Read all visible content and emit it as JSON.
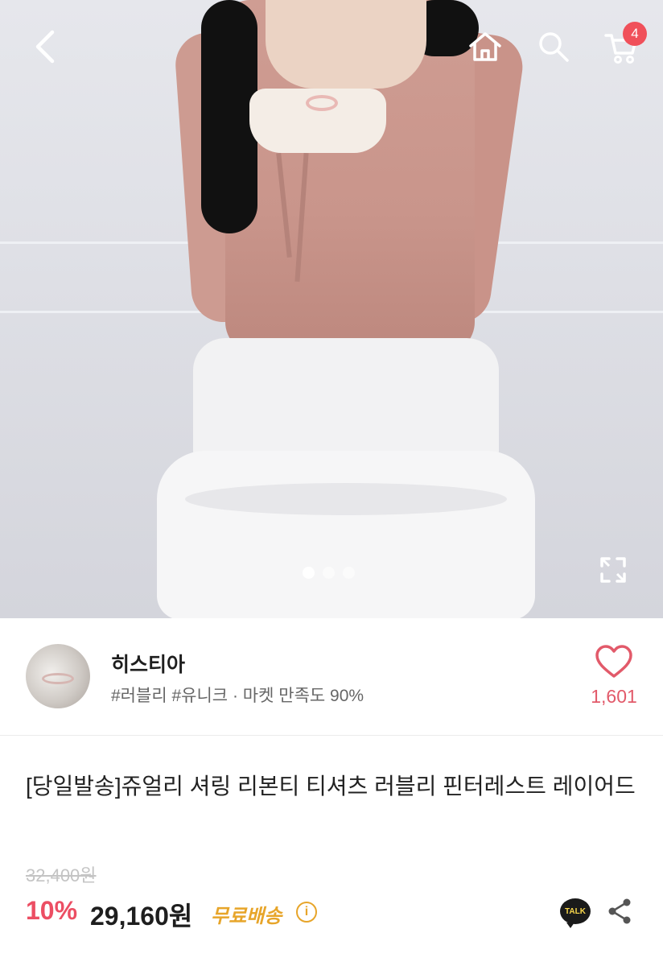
{
  "header": {
    "cart_count": "4"
  },
  "gallery": {
    "total_images": 3,
    "active_index": 0
  },
  "seller": {
    "name": "히스티아",
    "tags": "#러블리 #유니크 · 마켓 만족도 90%",
    "likes": "1,601"
  },
  "product": {
    "title": "[당일발송]쥬얼리 셔링 리본티 티셔츠 러블리 핀터레스트 레이어드",
    "original_price": "32,400원",
    "discount": "10%",
    "price": "29,160원",
    "shipping": "무료배송",
    "talk_label": "TALK",
    "info_label": "i"
  },
  "colors": {
    "accent": "#ec4e63",
    "badge": "#f0505a",
    "shipping": "#e7a52a"
  }
}
